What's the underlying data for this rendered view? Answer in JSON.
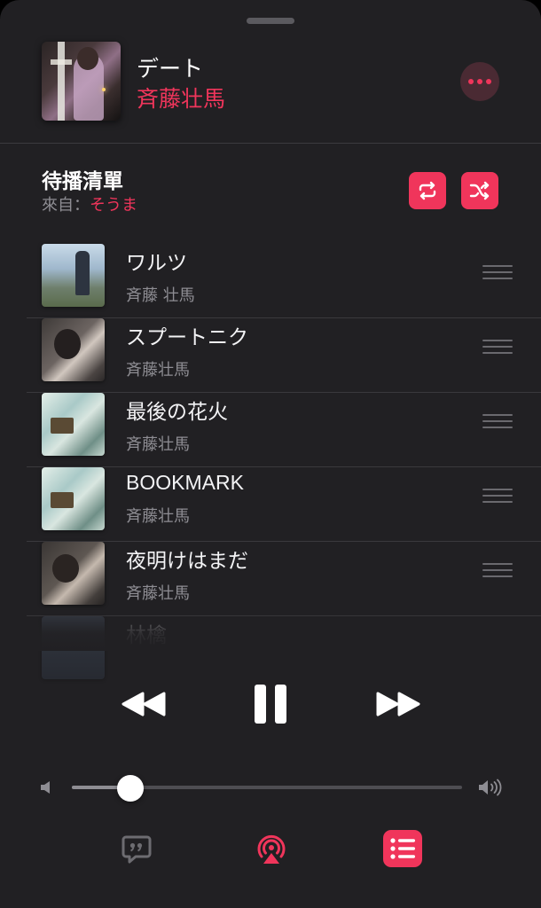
{
  "now_playing": {
    "title": "デート",
    "artist": "斉藤壮馬"
  },
  "queue": {
    "heading": "待播清單",
    "from_label": "來自：",
    "from_source": "そうま"
  },
  "tracks": [
    {
      "title": "ワルツ",
      "artist": "斉藤 壮馬"
    },
    {
      "title": "スプートニク",
      "artist": "斉藤壮馬"
    },
    {
      "title": "最後の花火",
      "artist": "斉藤壮馬"
    },
    {
      "title": "BOOKMARK",
      "artist": "斉藤壮馬"
    },
    {
      "title": "夜明けはまだ",
      "artist": "斉藤壮馬"
    },
    {
      "title": "林檎",
      "artist": ""
    }
  ],
  "volume": {
    "level": 0.15
  },
  "icons": {
    "more": "ellipsis-icon",
    "repeat": "repeat-icon",
    "shuffle": "shuffle-icon",
    "previous": "rewind-icon",
    "pause": "pause-icon",
    "next": "fast-forward-icon",
    "lyrics": "lyrics-icon",
    "airplay": "airplay-icon",
    "queue": "queue-list-icon"
  },
  "colors": {
    "accent": "#f0355b",
    "background": "#212023",
    "secondary_text": "#8e8d93"
  }
}
